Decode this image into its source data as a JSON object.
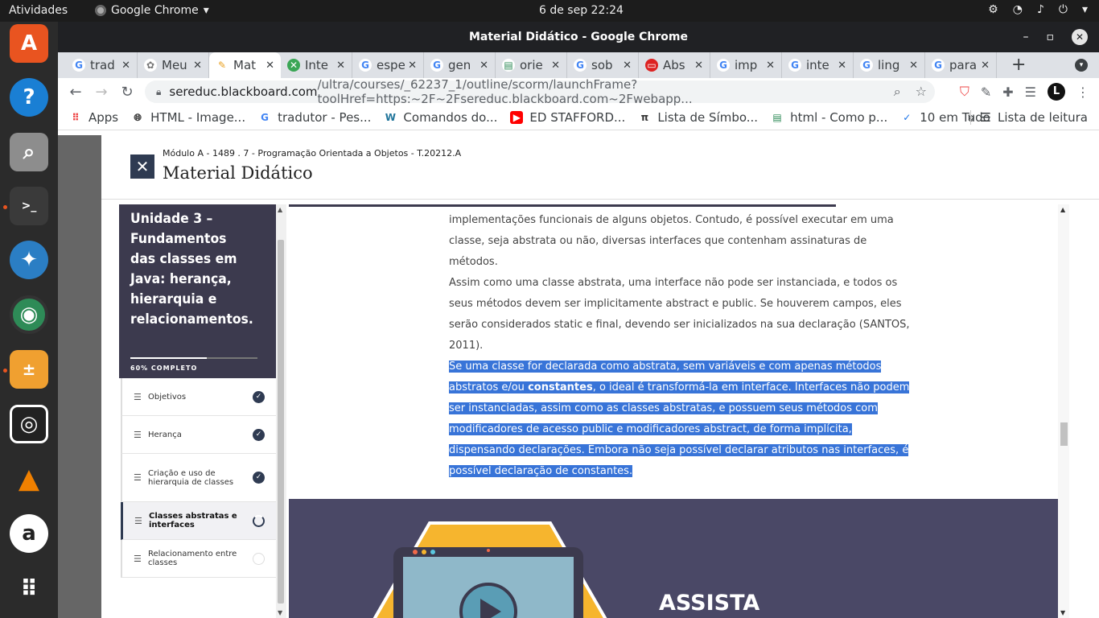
{
  "topbar": {
    "activities": "Atividades",
    "app": "Google Chrome",
    "clock": "6 de sep  22:24"
  },
  "window": {
    "title": "Material Didático - Google Chrome"
  },
  "tabs": [
    {
      "label": "trad",
      "favicon": "google-icon"
    },
    {
      "label": "Meu",
      "favicon": "bb-icon"
    },
    {
      "label": "Mat",
      "favicon": "pencil-icon",
      "active": true
    },
    {
      "label": "Inte",
      "favicon": "green-icon"
    },
    {
      "label": "espe",
      "favicon": "google-icon"
    },
    {
      "label": "gen",
      "favicon": "google-icon"
    },
    {
      "label": "orie",
      "favicon": "stack-icon"
    },
    {
      "label": "sob",
      "favicon": "google-icon"
    },
    {
      "label": "Abs",
      "favicon": "red-icon"
    },
    {
      "label": "imp",
      "favicon": "google-icon"
    },
    {
      "label": "inte",
      "favicon": "google-icon"
    },
    {
      "label": "ling",
      "favicon": "google-icon"
    },
    {
      "label": "para",
      "favicon": "google-icon"
    }
  ],
  "address": {
    "host": "sereduc.blackboard.com",
    "path": "/ultra/courses/_62237_1/outline/scorm/launchFrame?toolHref=https:~2F~2Fsereduc.blackboard.com~2Fwebapp..."
  },
  "bookmarks": [
    {
      "label": "Apps"
    },
    {
      "label": "HTML - Image..."
    },
    {
      "label": "tradutor - Pes..."
    },
    {
      "label": "Comandos do..."
    },
    {
      "label": "ED STAFFORD..."
    },
    {
      "label": "Lista de Símbo..."
    },
    {
      "label": "html - Como p..."
    },
    {
      "label": "10 em Tudo"
    }
  ],
  "reading_list": "Lista de leitura",
  "course": {
    "breadcrumb": "Módulo A - 1489 . 7 - Programação Orientada a Objetos - T.20212.A",
    "title": "Material Didático"
  },
  "sidebar": {
    "unit_title": "Unidade 3 – Fundamentos das classes em Java: herança, hierarquia e relacionamentos.",
    "progress_label": "60% COMPLETO",
    "progress": 0.6,
    "lessons": [
      {
        "label": "Objetivos",
        "status": "done"
      },
      {
        "label": "Herança",
        "status": "done"
      },
      {
        "label": "Criação e uso de hierarquia de classes",
        "status": "done"
      },
      {
        "label": "Classes abstratas e interfaces",
        "status": "in-progress"
      },
      {
        "label": "Relacionamento entre classes",
        "status": "todo"
      }
    ]
  },
  "content": {
    "p1": "implementações funcionais de alguns objetos. Contudo, é possível executar em uma classe, seja abstrata ou não, diversas interfaces que contenham assinaturas de métodos.",
    "p2": "Assim como uma classe abstrata, uma interface não pode ser instanciada, e todos os seus métodos devem ser implicitamente abstract e public. Se houverem campos, eles serão considerados static e final, devendo ser inicializados na sua declaração (SANTOS, 2011).",
    "p3_a": "Se uma classe for declarada como abstrata, sem variáveis e com apenas métodos abstratos e/ou ",
    "p3_bold": "constantes",
    "p3_b": ", o ideal é transformá-la em interface. Interfaces não podem ser instanciadas, assim como as classes abstratas, e possuem seus métodos com modificadores de acesso public e modificadores abstract, de forma implícita, dispensando declarações. Embora não seja possível declarar atributos nas interfaces, é possível declaração de constantes.",
    "banner_label": "ASSISTA"
  },
  "colors": {
    "selection": "#3874d8",
    "sidebar_header": "#3c3a4e",
    "banner": "#4a4866",
    "accent": "#2f3b52"
  }
}
